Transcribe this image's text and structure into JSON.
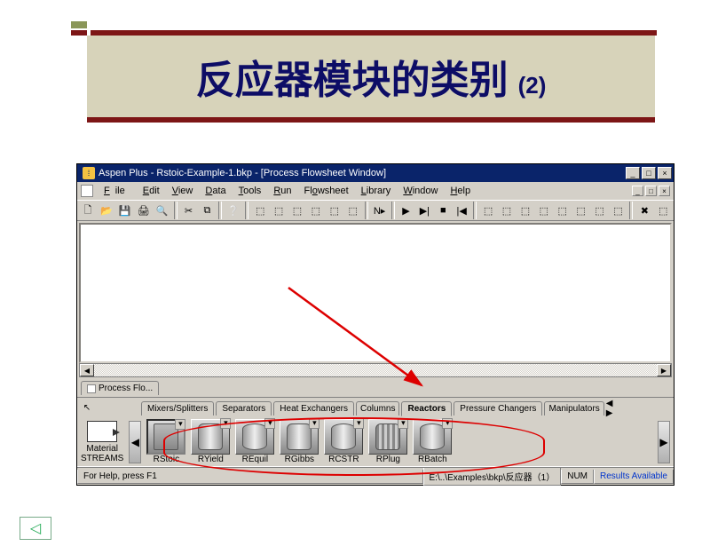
{
  "slide": {
    "title": "反应器模块的类别",
    "subtitle": "(2)"
  },
  "window": {
    "title": "Aspen Plus - Rstoic-Example-1.bkp - [Process Flowsheet Window]",
    "min": "_",
    "max": "□",
    "close": "×"
  },
  "menu": {
    "file": "File",
    "edit": "Edit",
    "view": "View",
    "data": "Data",
    "tools": "Tools",
    "run": "Run",
    "flowsheet": "Flowsheet",
    "library": "Library",
    "window": "Window",
    "help": "Help"
  },
  "toolbar_icons": {
    "new": "🗋",
    "open": "📂",
    "save": "💾",
    "print": "🖨",
    "prev": "🔍",
    "cut": "✂",
    "copy": "⧉",
    "help": "❔",
    "g1": "⬚",
    "g2": "⬚",
    "g3": "⬚",
    "g4": "⬚",
    "g5": "⬚",
    "g6": "⬚",
    "next": "N▸",
    "sep": "|",
    "r1": "▶",
    "r2": "▶|",
    "r3": "■",
    "r4": "|◀",
    "c1": "⬚",
    "c2": "⬚",
    "c3": "⬚",
    "c4": "⬚",
    "c5": "⬚",
    "c6": "⬚",
    "c7": "⬚",
    "c8": "⬚",
    "x1": "✖",
    "x2": "⬚"
  },
  "doctab": {
    "label": "Process Flo..."
  },
  "palette": {
    "streams_label1": "Material",
    "streams_label2": "STREAMS",
    "tabs": {
      "mixers": "Mixers/Splitters",
      "separators": "Separators",
      "heatx": "Heat Exchangers",
      "columns": "Columns",
      "reactors": "Reactors",
      "pressure": "Pressure Changers",
      "manip": "Manipulators"
    },
    "reactors": {
      "rstoic": "RStoic",
      "ryield": "RYield",
      "requil": "REquil",
      "rgibbs": "RGibbs",
      "rcstr": "RCSTR",
      "rplug": "RPlug",
      "rbatch": "RBatch"
    },
    "nav_left": "◀",
    "nav_right": "▶",
    "nav_more": "◀ ▶"
  },
  "status": {
    "help": "For Help, press F1",
    "path": "E:\\..\\Examples\\bkp\\反应器（1）",
    "num": "NUM",
    "results": "Results Available"
  },
  "back": "◁"
}
